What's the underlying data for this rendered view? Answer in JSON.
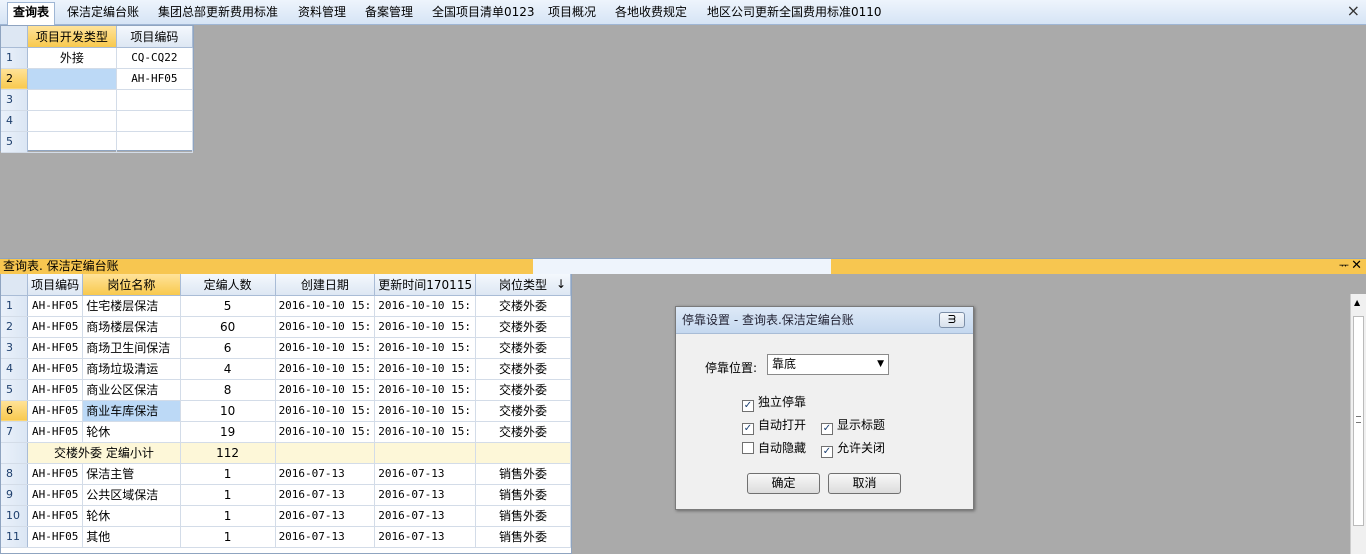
{
  "tabs": [
    "查询表",
    "保洁定编台账",
    "集团总部更新费用标准",
    "资料管理",
    "备案管理",
    "全国项目清单0123",
    "项目概况",
    "各地收费规定",
    "地区公司更新全国费用标准0110"
  ],
  "tab_close_glyph": "×",
  "top_grid": {
    "headers": [
      "项目开发类型",
      "项目编码"
    ],
    "row_numbers": [
      "1",
      "2",
      "3",
      "4",
      "5"
    ],
    "rows": [
      [
        "外接",
        "CQ-CQ22"
      ],
      [
        "",
        "AH-HF05"
      ],
      [
        "",
        ""
      ],
      [
        "",
        ""
      ],
      [
        "",
        ""
      ]
    ]
  },
  "dock": {
    "title": "查询表. 保洁定编台账",
    "pin_glyph": "ᅲ",
    "close_glyph": "✕"
  },
  "main_grid": {
    "headers": [
      "项目编码",
      "岗位名称",
      "定编人数",
      "创建日期",
      "更新时间170115",
      "岗位类型"
    ],
    "sort_glyph": "↓",
    "rows": [
      {
        "n": "1",
        "cells": [
          "AH-HF05",
          "住宅楼层保洁",
          "5",
          "2016-10-10  15:",
          "2016-10-10  15:",
          "交楼外委"
        ]
      },
      {
        "n": "2",
        "cells": [
          "AH-HF05",
          "商场楼层保洁",
          "60",
          "2016-10-10  15:",
          "2016-10-10  15:",
          "交楼外委"
        ]
      },
      {
        "n": "3",
        "cells": [
          "AH-HF05",
          "商场卫生间保洁",
          "6",
          "2016-10-10  15:",
          "2016-10-10  15:",
          "交楼外委"
        ]
      },
      {
        "n": "4",
        "cells": [
          "AH-HF05",
          "商场垃圾清运",
          "4",
          "2016-10-10  15:",
          "2016-10-10  15:",
          "交楼外委"
        ]
      },
      {
        "n": "5",
        "cells": [
          "AH-HF05",
          "商业公区保洁",
          "8",
          "2016-10-10  15:",
          "2016-10-10  15:",
          "交楼外委"
        ]
      },
      {
        "n": "6",
        "cells": [
          "AH-HF05",
          "商业车库保洁",
          "10",
          "2016-10-10  15:",
          "2016-10-10  15:",
          "交楼外委"
        ]
      },
      {
        "n": "7",
        "cells": [
          "AH-HF05",
          "轮休",
          "19",
          "2016-10-10  15:",
          "2016-10-10  15:",
          "交楼外委"
        ]
      },
      {
        "n": "",
        "subtotal": true,
        "cells": [
          "交楼外委  定编小计",
          "112"
        ]
      },
      {
        "n": "8",
        "cells": [
          "AH-HF05",
          "保洁主管",
          "1",
          "2016-07-13",
          "2016-07-13",
          "销售外委"
        ]
      },
      {
        "n": "9",
        "cells": [
          "AH-HF05",
          "公共区域保洁",
          "1",
          "2016-07-13",
          "2016-07-13",
          "销售外委"
        ]
      },
      {
        "n": "10",
        "cells": [
          "AH-HF05",
          "轮休",
          "1",
          "2016-07-13",
          "2016-07-13",
          "销售外委"
        ]
      },
      {
        "n": "11",
        "cells": [
          "AH-HF05",
          "其他",
          "1",
          "2016-07-13",
          "2016-07-13",
          "销售外委"
        ]
      }
    ]
  },
  "dialog": {
    "title": "停靠设置 - 查询表.保洁定编台账",
    "close_glyph": "ᗱ",
    "position_label": "停靠位置:",
    "position_value": "靠底",
    "checkboxes": {
      "standalone": {
        "label": "独立停靠",
        "checked": true
      },
      "auto_open": {
        "label": "自动打开",
        "checked": true
      },
      "show_title": {
        "label": "显示标题",
        "checked": true
      },
      "auto_hide": {
        "label": "自动隐藏",
        "checked": false
      },
      "allow_close": {
        "label": "允许关闭",
        "checked": true
      }
    },
    "ok_label": "确定",
    "cancel_label": "取消"
  }
}
